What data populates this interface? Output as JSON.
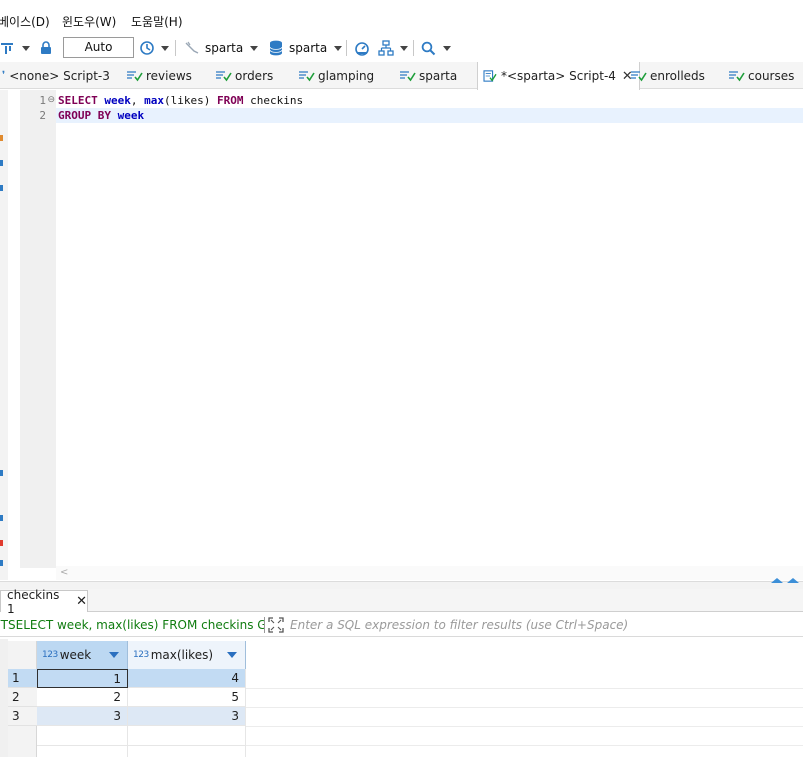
{
  "menu": {
    "items": [
      {
        "label": "베이스(D)"
      },
      {
        "label": "윈도우(W)"
      },
      {
        "label": "도움말(H)"
      }
    ]
  },
  "toolbar": {
    "transaction_mode": "Auto",
    "connection": "sparta",
    "database": "sparta"
  },
  "tabs": [
    {
      "label": "<none> Script-3",
      "icon": "script-icon",
      "active": false
    },
    {
      "label": "reviews",
      "icon": "table-icon",
      "active": false
    },
    {
      "label": "orders",
      "icon": "table-icon",
      "active": false
    },
    {
      "label": "glamping",
      "icon": "table-icon",
      "active": false
    },
    {
      "label": "sparta",
      "icon": "table-icon",
      "active": false
    },
    {
      "label": "*<sparta> Script-4",
      "icon": "script-icon",
      "active": true
    },
    {
      "label": "enrolleds",
      "icon": "table-icon",
      "active": false
    },
    {
      "label": "courses",
      "icon": "table-icon",
      "active": false
    }
  ],
  "editor": {
    "lines": [
      {
        "number": "1"
      },
      {
        "number": "2"
      }
    ]
  },
  "results": {
    "tab_label": "checkins 1",
    "query_text": "SELECT week, max(likes) FROM checkins GRC",
    "filter_placeholder": "Enter a SQL expression to filter results (use Ctrl+Space)",
    "columns": [
      {
        "type": "123",
        "name": "week"
      },
      {
        "type": "123",
        "name": "max(likes)"
      }
    ],
    "rows": [
      {
        "num": "1",
        "week": "1",
        "max_likes": "4"
      },
      {
        "num": "2",
        "week": "2",
        "max_likes": "5"
      },
      {
        "num": "3",
        "week": "3",
        "max_likes": "3"
      }
    ]
  },
  "colors": {
    "keyword": "#7f0055",
    "identifier": "#0000c0",
    "accent": "#3c8fd8",
    "header": "#bcd8f2"
  }
}
